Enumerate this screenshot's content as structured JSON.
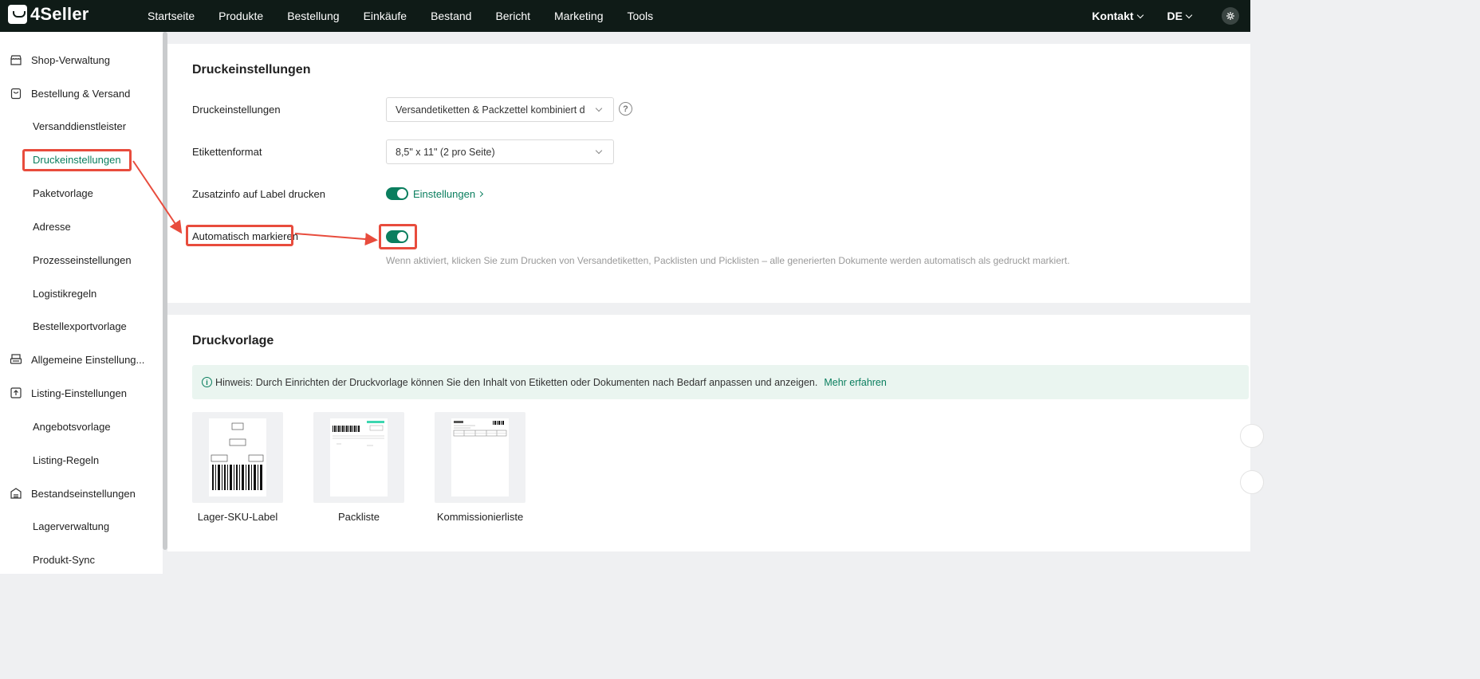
{
  "app": {
    "logo_text": "4Seller",
    "nav": [
      "Startseite",
      "Produkte",
      "Bestellung",
      "Einkäufe",
      "Bestand",
      "Bericht",
      "Marketing",
      "Tools"
    ],
    "contact_label": "Kontakt",
    "language": "DE",
    "accent_color": "#0a7e5e"
  },
  "sidebar": {
    "items": [
      {
        "label": "Shop-Verwaltung",
        "type": "group",
        "icon": "store-icon"
      },
      {
        "label": "Bestellung & Versand",
        "type": "group",
        "icon": "shopping-bag-icon"
      },
      {
        "label": "Versanddienstleister",
        "type": "sub"
      },
      {
        "label": "Druckeinstellungen",
        "type": "sub",
        "active": true
      },
      {
        "label": "Paketvorlage",
        "type": "sub"
      },
      {
        "label": "Adresse",
        "type": "sub"
      },
      {
        "label": "Prozesseinstellungen",
        "type": "sub"
      },
      {
        "label": "Logistikregeln",
        "type": "sub"
      },
      {
        "label": "Bestellexportvorlage",
        "type": "sub"
      },
      {
        "label": "Allgemeine Einstellung...",
        "type": "group",
        "icon": "printer-icon"
      },
      {
        "label": "Listing-Einstellungen",
        "type": "group",
        "icon": "upload-icon"
      },
      {
        "label": "Angebotsvorlage",
        "type": "sub"
      },
      {
        "label": "Listing-Regeln",
        "type": "sub"
      },
      {
        "label": "Bestandseinstellungen",
        "type": "group",
        "icon": "warehouse-icon"
      },
      {
        "label": "Lagerverwaltung",
        "type": "sub"
      },
      {
        "label": "Produkt-Sync",
        "type": "sub"
      }
    ]
  },
  "print_settings": {
    "title": "Druckeinstellungen",
    "print_label": "Druckeinstellungen",
    "print_value": "Versandetiketten & Packzettel kombiniert dr...",
    "format_label": "Etikettenformat",
    "format_value": "8,5\" x 11\" (2 pro Seite)",
    "extra_info_label": "Zusatzinfo auf Label drucken",
    "extra_info_enabled": true,
    "extra_info_link": "Einstellungen",
    "auto_mark_label": "Automatisch markieren",
    "auto_mark_enabled": true,
    "auto_mark_hint": "Wenn aktiviert, klicken Sie zum Drucken von Versandetiketten, Packlisten und Picklisten – alle generierten Dokumente werden automatisch als gedruckt markiert."
  },
  "print_template": {
    "title": "Druckvorlage",
    "notice": "Hinweis: Durch Einrichten der Druckvorlage können Sie den Inhalt von Etiketten oder Dokumenten nach Bedarf anpassen und anzeigen.",
    "notice_link": "Mehr erfahren",
    "templates": [
      {
        "name": "Lager-SKU-Label"
      },
      {
        "name": "Packliste"
      },
      {
        "name": "Kommissionierliste"
      }
    ]
  },
  "annotation_color": "#e84c3d"
}
